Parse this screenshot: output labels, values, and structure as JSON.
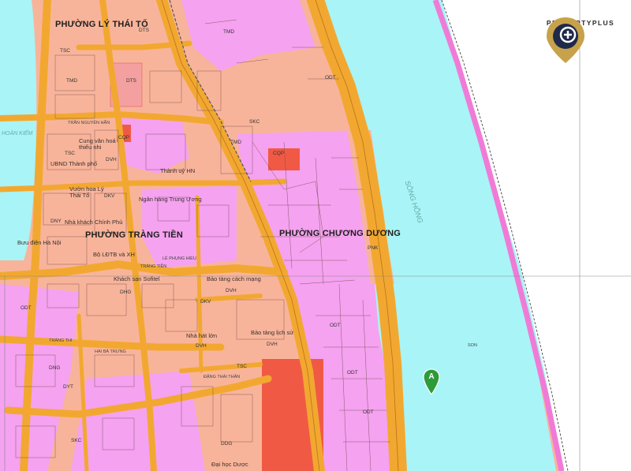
{
  "brand": {
    "name": "PROPERTYPLUS",
    "colors": {
      "gold": "#c8a24a",
      "navy": "#1f2a4a"
    }
  },
  "marker": {
    "label": "A",
    "color": "#2e9b3a"
  },
  "colors": {
    "river": "#a9f4f6",
    "land_residential": "#f5a2f0",
    "land_public": "#f8b49a",
    "road": "#f2a830",
    "dyke": "#e89a2e",
    "bank_line": "#f07bd6",
    "lake": "#a9f4f6"
  },
  "labels": {
    "ward_ly_thai_to": "PHƯỜNG LÝ THÁI TỔ",
    "ward_trang_tien": "PHƯỜNG TRÀNG TIỀN",
    "ward_chuong_duong": "PHƯỜNG CHƯƠNG DƯƠNG",
    "song_hong": "SÔNG HỒNG",
    "hoan_kiem": "HOÀN KIẾM",
    "son": "SON",
    "cung_van_hoa": "Cung văn hoá thiếu nhi",
    "ubnd": "UBND Thành phố",
    "vuon_hoa": "Vườn hoa Lý Thái Tổ",
    "nha_khach": "Nhà khách Chính Phủ",
    "buu_dien": "Bưu điện Hà Nội",
    "bo_ldtb": "Bộ LĐTB và XH",
    "ngan_hang": "Ngân hàng Trung Ương",
    "thanh_uy": "Thành uỷ HN",
    "khach_san": "Khách sạn Sofitel",
    "bao_tang_cm": "Bảo tàng cách mạng",
    "nha_hat": "Nhà hát lớn",
    "bao_tang_ls": "Bảo tàng lịch sử",
    "dai_hoc_duoc": "Đại học Dược",
    "tran_nguyen_han": "TRẦN NGUYÊN HÃN",
    "le_phung_hieu": "LÊ PHỤNG HIỂU",
    "hai_ba_trung": "HAI BÀ TRƯNG",
    "trang_thi": "TRÀNG THI",
    "dang_thai_than": "ĐẶNG THÁI THÂN",
    "trang_tien": "TRÀNG TIỀN",
    "codes": {
      "dts": "DTS",
      "tmd": "TMD",
      "tsc": "TSC",
      "odt": "ODT",
      "cqp": "CQP",
      "dvh": "DVH",
      "dkv": "DKV",
      "dny": "DNY",
      "dng": "DNG",
      "skc": "SKC",
      "pnk": "PNK",
      "ddg": "DDG",
      "dyt": "DYT",
      "dhg": "DHG"
    }
  }
}
